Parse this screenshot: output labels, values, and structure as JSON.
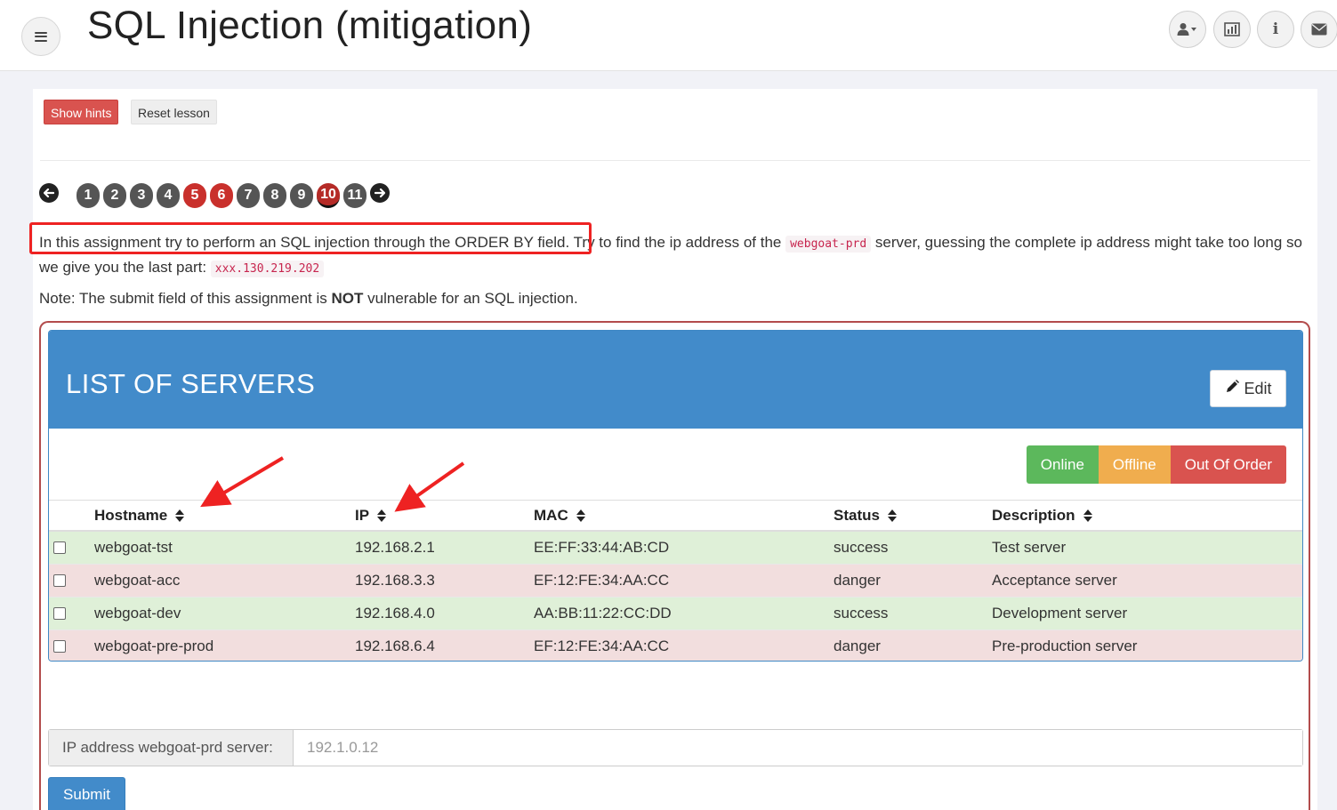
{
  "header": {
    "title": "SQL Injection (mitigation)",
    "menu_icon": "hamburger-icon",
    "right_icons": [
      "user-dropdown-icon",
      "report-card-icon",
      "about-info-icon",
      "contact-mail-icon"
    ],
    "info_glyph": "i"
  },
  "toolbar": {
    "show_hints_label": "Show hints",
    "reset_lesson_label": "Reset lesson"
  },
  "pagination": {
    "pages": [
      "1",
      "2",
      "3",
      "4",
      "5",
      "6",
      "7",
      "8",
      "9",
      "10",
      "11"
    ],
    "red_pages": [
      "5",
      "6",
      "10"
    ],
    "current": "10"
  },
  "description": {
    "part1": "In this assignment try to perform an SQL injection through the ORDER BY field.",
    "part2": " Try to find the ip address of the ",
    "code1": "webgoat-prd",
    "part3": " server, guessing the complete ip address might take too long so we give you the last part: ",
    "code2": "xxx.130.219.202",
    "note_prefix": "Note: The submit field of this assignment is ",
    "note_bold": "NOT",
    "note_suffix": " vulnerable for an SQL injection."
  },
  "servers": {
    "title": "LIST OF SERVERS",
    "edit_label": "Edit",
    "status_buttons": {
      "online": "Online",
      "offline": "Offline",
      "out_of_order": "Out Of Order"
    },
    "columns": [
      "Hostname",
      "IP",
      "MAC",
      "Status",
      "Description"
    ],
    "rows": [
      {
        "hostname": "webgoat-tst",
        "ip": "192.168.2.1",
        "mac": "EE:FF:33:44:AB:CD",
        "status": "success",
        "description": "Test server"
      },
      {
        "hostname": "webgoat-acc",
        "ip": "192.168.3.3",
        "mac": "EF:12:FE:34:AA:CC",
        "status": "danger",
        "description": "Acceptance server"
      },
      {
        "hostname": "webgoat-dev",
        "ip": "192.168.4.0",
        "mac": "AA:BB:11:22:CC:DD",
        "status": "success",
        "description": "Development server"
      },
      {
        "hostname": "webgoat-pre-prod",
        "ip": "192.168.6.4",
        "mac": "EF:12:FE:34:AA:CC",
        "status": "danger",
        "description": "Pre-production server"
      }
    ]
  },
  "form": {
    "ip_label": "IP address webgoat-prd server:",
    "ip_placeholder": "192.1.0.12",
    "submit_label": "Submit"
  },
  "colors": {
    "hint_red": "#d9534f",
    "panel_blue": "#428bca",
    "success_bg": "#dff0d8",
    "danger_bg": "#f2dede",
    "annotation_red": "#ee2222"
  }
}
